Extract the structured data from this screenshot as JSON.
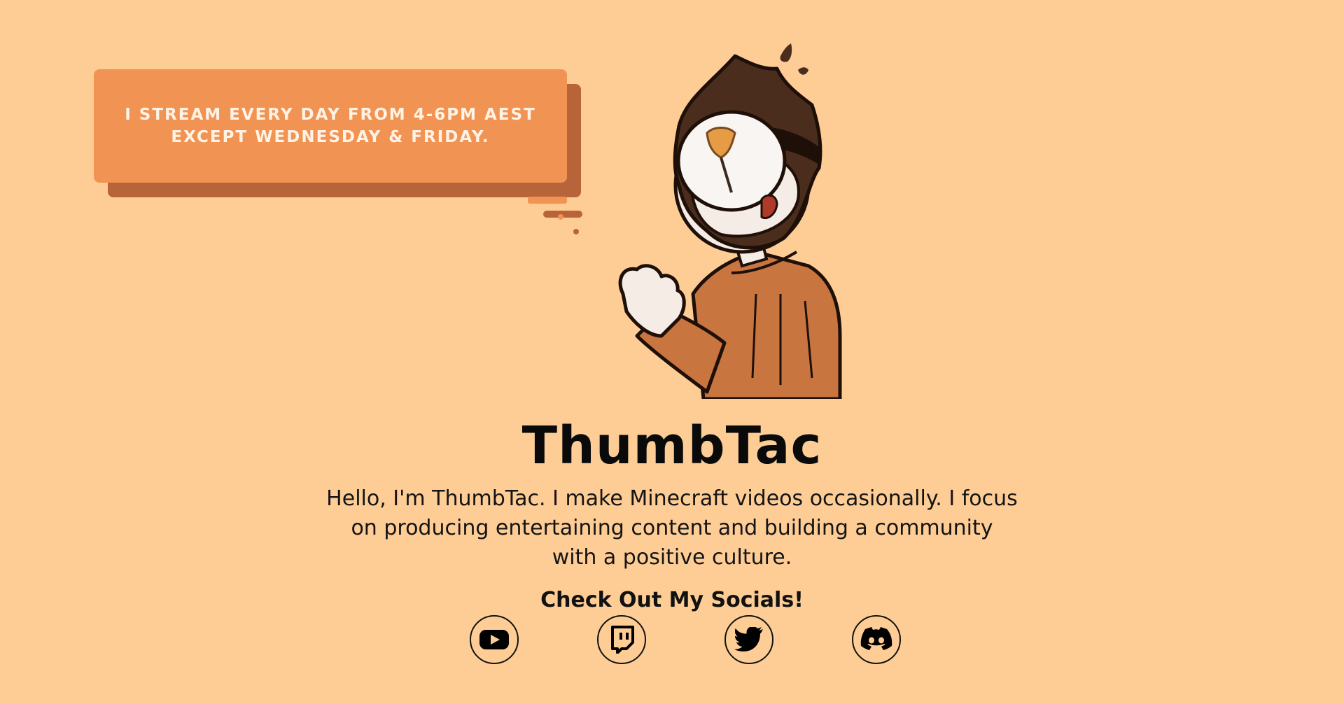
{
  "bubble": {
    "line1": "I STREAM EVERY DAY FROM 4-6PM AEST",
    "line2": "EXCEPT WEDNESDAY & FRIDAY."
  },
  "profile": {
    "name": "ThumbTac",
    "bio_line1": "Hello, I'm ThumbTac. I make Minecraft videos occasionally. I focus",
    "bio_line2": "on producing entertaining content and building a community",
    "bio_line3": "with a positive culture."
  },
  "socials": {
    "heading": "Check Out My Socials!",
    "links": [
      {
        "icon": "youtube-icon"
      },
      {
        "icon": "twitch-icon"
      },
      {
        "icon": "twitter-icon"
      },
      {
        "icon": "discord-icon"
      }
    ]
  },
  "colors": {
    "background": "#fecd96",
    "bubble": "#f19352",
    "bubble_shadow": "#b8643a",
    "text": "#0a0a0a"
  }
}
